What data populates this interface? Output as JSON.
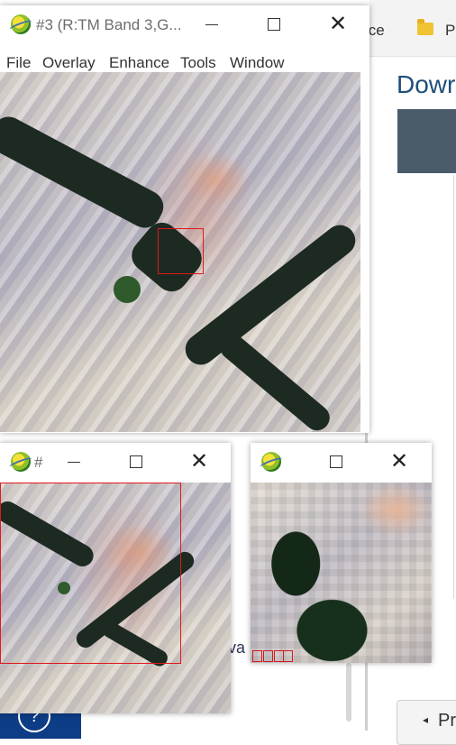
{
  "background": {
    "tab_fragment_1": "ice",
    "tab_fragment_2": "Pe",
    "heading_fragment": "Dowr",
    "peek_text": "va",
    "prev_button": {
      "label": "Pr",
      "arrow": "◂"
    },
    "help_icon": "?"
  },
  "main_window": {
    "title": "#3 (R:TM Band 3,G...",
    "controls": {
      "minimize": "—",
      "maximize": "",
      "close": "✕"
    },
    "menu": [
      "File",
      "Overlay",
      "Enhance",
      "Tools",
      "Window"
    ]
  },
  "scroll_window": {
    "title": "#",
    "controls": {
      "minimize": "—",
      "maximize": "",
      "close": "✕"
    }
  },
  "zoom_window": {
    "title": "",
    "controls": {
      "maximize": "",
      "close": "✕"
    }
  },
  "colors": {
    "selection_box": "#e0191c",
    "heading": "#1e4e79",
    "banner": "#4a5b6a",
    "help_bar": "#0d3d86"
  },
  "icons": {
    "app": "envi-globe-icon",
    "folder": "folder-icon"
  }
}
